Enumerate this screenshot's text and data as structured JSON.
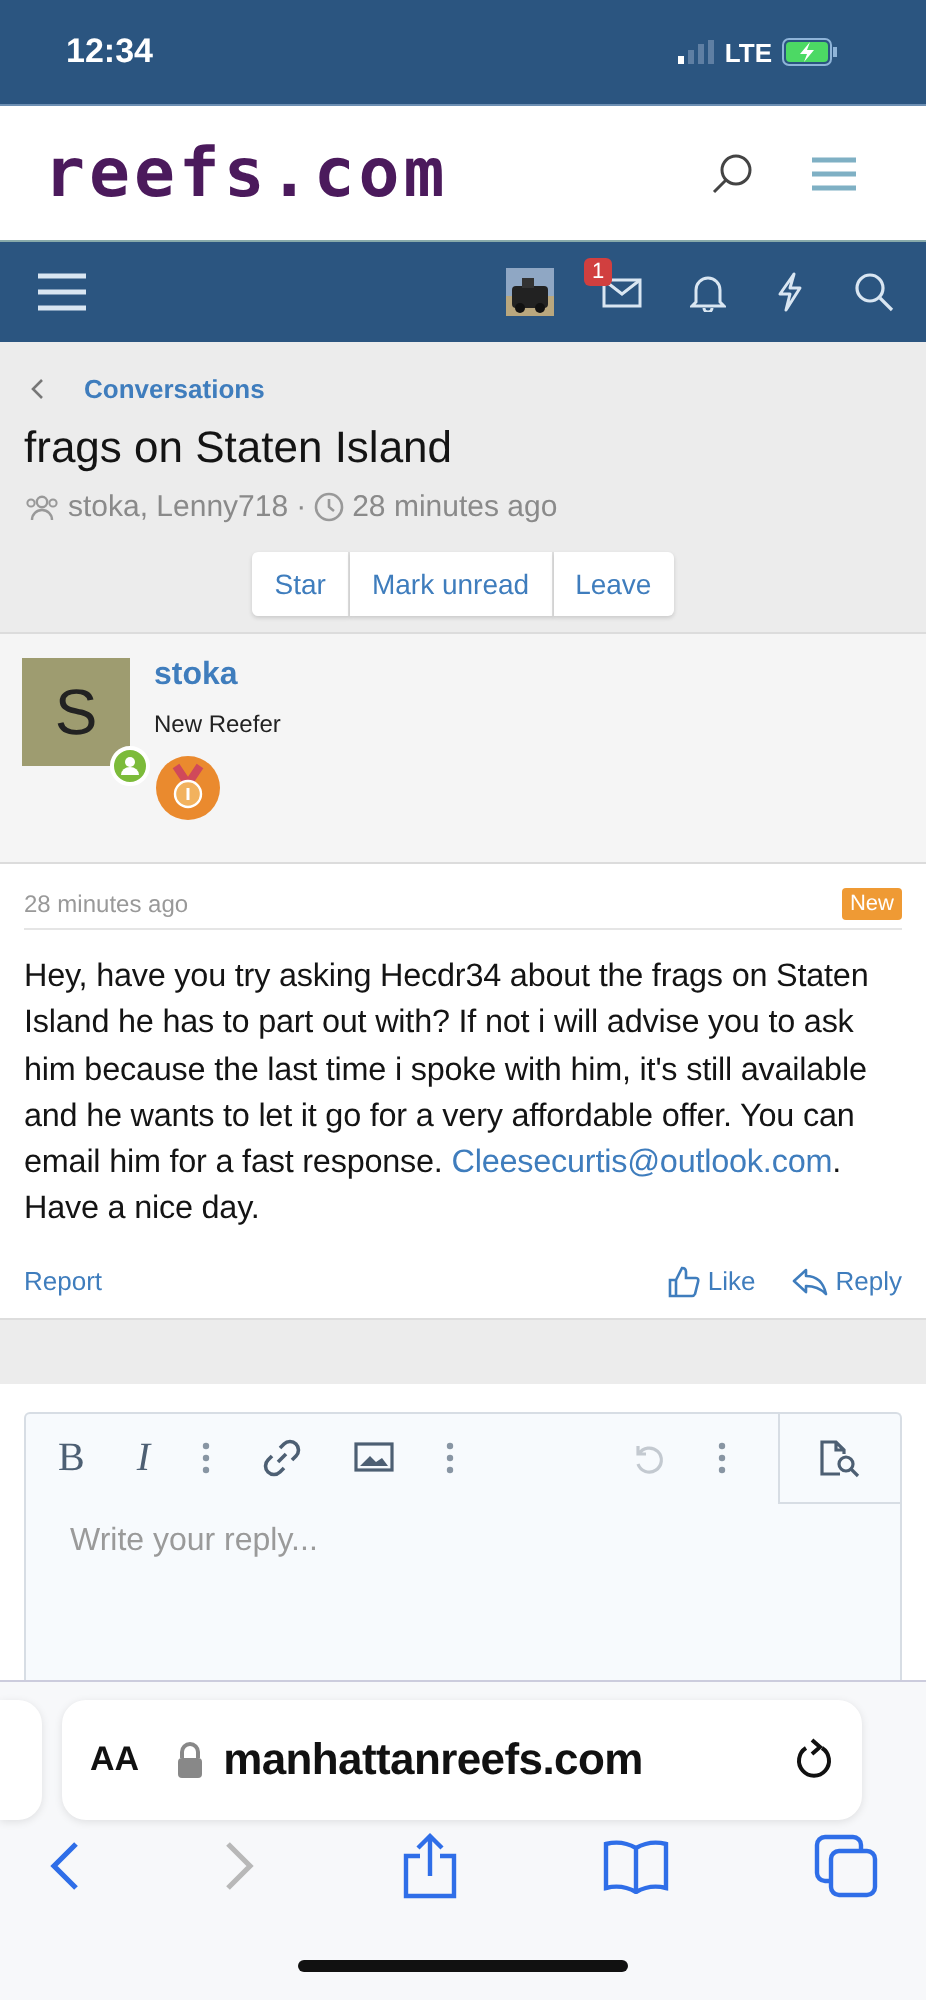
{
  "status_bar": {
    "time": "12:34",
    "network": "LTE"
  },
  "site_header": {
    "logo": "reefs.com"
  },
  "nav_bar": {
    "notification_count": "1"
  },
  "breadcrumb": {
    "label": "Conversations"
  },
  "conversation": {
    "title": "frags on Staten Island",
    "participants": "stoka, Lenny718",
    "separator": "·",
    "time": "28 minutes ago"
  },
  "actions": [
    {
      "label": "Star"
    },
    {
      "label": "Mark unread"
    },
    {
      "label": "Leave"
    }
  ],
  "message": {
    "avatar_letter": "S",
    "author": "stoka",
    "user_title": "New Reefer",
    "online": true,
    "time": "28 minutes ago",
    "badge": "New",
    "body": "Hey, have you try asking Hecdr34 about the frags on Staten Island he has to part out with? If not i will advise you to ask him because the last time i spoke with him, it's still available and he wants to let it go for a very affordable offer. You can email him for a fast response.",
    "link": "Cleesecurtis@outlook.com",
    "body_end": ". Have a nice day.",
    "report": "Report",
    "like": "Like",
    "reply": "Reply"
  },
  "editor": {
    "bold": "B",
    "italic": "I",
    "placeholder": "Write your reply..."
  },
  "browser": {
    "text_size": "AA",
    "url": "manhattanreefs.com"
  }
}
